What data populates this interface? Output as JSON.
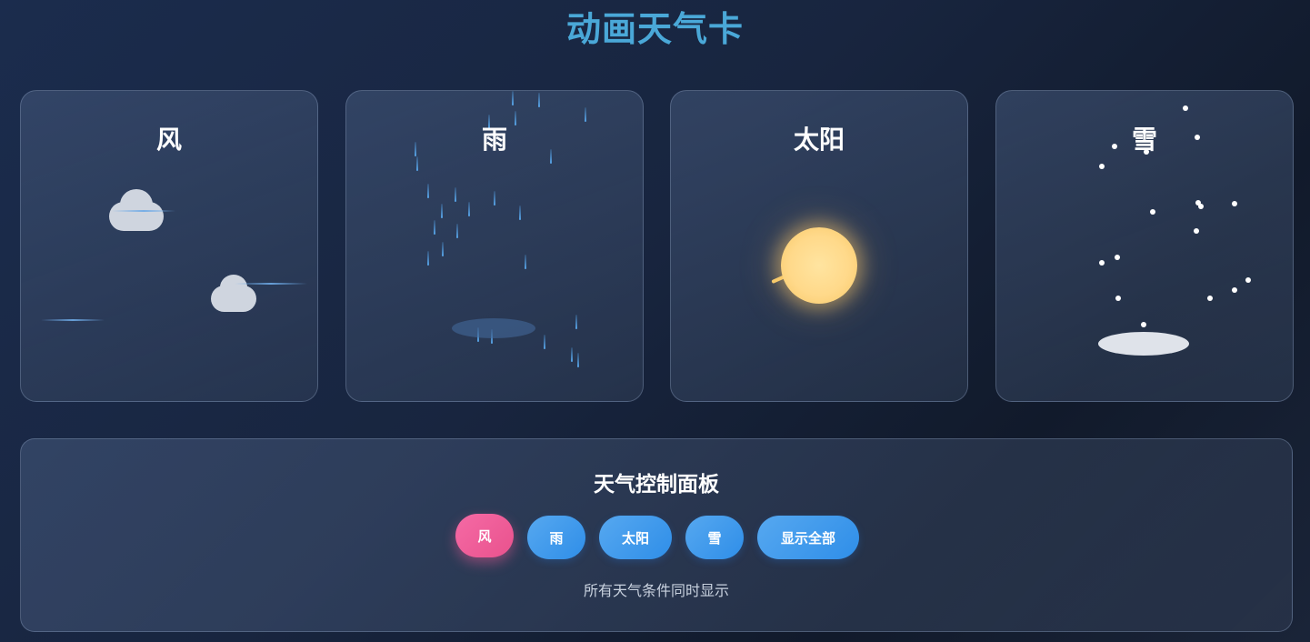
{
  "page": {
    "title": "动画天气卡"
  },
  "cards": {
    "wind": {
      "title": "风"
    },
    "rain": {
      "title": "雨"
    },
    "sun": {
      "title": "太阳"
    },
    "snow": {
      "title": "雪"
    }
  },
  "control_panel": {
    "title": "天气控制面板",
    "buttons": {
      "wind": "风",
      "rain": "雨",
      "sun": "太阳",
      "snow": "雪",
      "show_all": "显示全部"
    },
    "active_button": "wind",
    "status_text": "所有天气条件同时显示"
  },
  "colors": {
    "title_accent": "#4aa8d8",
    "button_blue": "#3a96ea",
    "button_active_pink": "#ee5c97",
    "sun_yellow": "#ffd98a",
    "rain_blue": "#5aaaf0"
  }
}
